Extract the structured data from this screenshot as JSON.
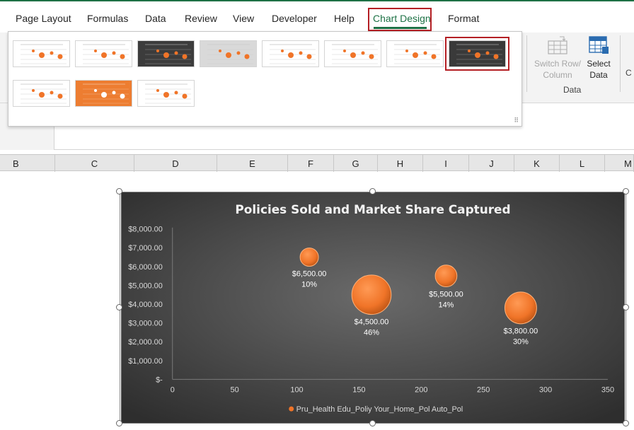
{
  "ribbon": {
    "tabs": [
      {
        "label": "Page Layout",
        "active": false
      },
      {
        "label": "Formulas",
        "active": false
      },
      {
        "label": "Data",
        "active": false
      },
      {
        "label": "Review",
        "active": false
      },
      {
        "label": "View",
        "active": false
      },
      {
        "label": "Developer",
        "active": false
      },
      {
        "label": "Help",
        "active": false
      },
      {
        "label": "Chart Design",
        "active": true
      },
      {
        "label": "Format",
        "active": false
      }
    ],
    "switch_row_column": "Switch Row/\nColumn",
    "select_data": "Select\nData",
    "data_group_label": "Data",
    "edge_letter": "C",
    "icons": {
      "switch": "switch-row-column-icon",
      "select": "select-data-icon"
    }
  },
  "gallery": {
    "styles_count": 11,
    "selected_index": 7
  },
  "columns": [
    "B",
    "C",
    "D",
    "E",
    "F",
    "G",
    "H",
    "I",
    "J",
    "K",
    "L",
    "M"
  ],
  "colors": {
    "excel_green": "#1e7145",
    "highlight_red": "#b41f24",
    "bubble_orange": "#f07428",
    "chart_dark": "#404040"
  },
  "chart_data": {
    "type": "bubble",
    "title": "Policies Sold and Market Share Captured",
    "x_ticks": [
      "0",
      "50",
      "100",
      "150",
      "200",
      "250",
      "300",
      "350"
    ],
    "y_ticks": [
      "$-",
      "$1,000.00",
      "$2,000.00",
      "$3,000.00",
      "$4,000.00",
      "$5,000.00",
      "$6,000.00",
      "$7,000.00",
      "$8,000.00"
    ],
    "xlim": [
      0,
      350
    ],
    "ylim": [
      0,
      8000
    ],
    "grid": false,
    "legend_position": "bottom",
    "legend_text": "Pru_Health Edu_Poliy Your_Home_Pol Auto_Pol",
    "points": [
      {
        "x": 110,
        "y": 6500,
        "size": 10,
        "label_value": "$6,500.00",
        "label_share": "10%"
      },
      {
        "x": 160,
        "y": 4500,
        "size": 46,
        "label_value": "$4,500.00",
        "label_share": "46%"
      },
      {
        "x": 220,
        "y": 5500,
        "size": 14,
        "label_value": "$5,500.00",
        "label_share": "14%"
      },
      {
        "x": 280,
        "y": 3800,
        "size": 30,
        "label_value": "$3,800.00",
        "label_share": "30%"
      }
    ]
  }
}
